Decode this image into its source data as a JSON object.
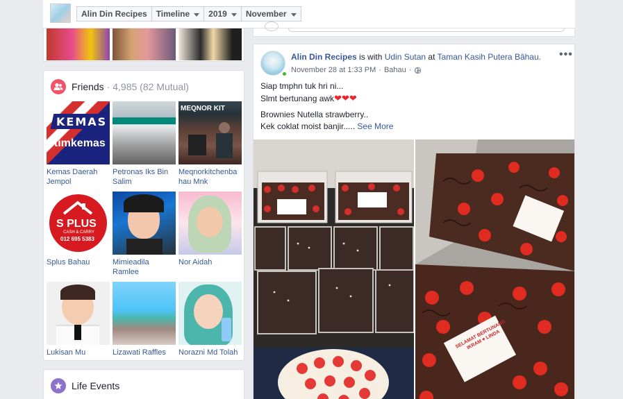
{
  "topbar": {
    "crumbs": [
      {
        "label": "Alin Din Recipes",
        "has_caret": false
      },
      {
        "label": "Timeline",
        "has_caret": true
      },
      {
        "label": "2019",
        "has_caret": true
      },
      {
        "label": "November",
        "has_caret": true
      }
    ]
  },
  "friends": {
    "title": "Friends",
    "subtitle": "· 4,985 (82 Mutual)",
    "items": [
      {
        "name": "Kemas Daerah Jempol"
      },
      {
        "name": "Petronas Iks Bin Salim"
      },
      {
        "name": "Meqnorkitchenba hau Mnk"
      },
      {
        "name": "Splus Bahau"
      },
      {
        "name": "Mimieadila Ramlee"
      },
      {
        "name": "Nor Aidah"
      },
      {
        "name": "Lukisan Mu"
      },
      {
        "name": "Lizawati Raffles"
      },
      {
        "name": "Norazni Md Tolah"
      }
    ],
    "image_text": {
      "kemas_logo": "KEMAS",
      "kemas_hashtag": "#timkemas",
      "meqnor_sign": "MEQNOR KIT",
      "splus_brand": "S PLUS",
      "splus_sub": "CASH & CARRY",
      "splus_phone": "012 695 5383"
    }
  },
  "life_events": {
    "title": "Life Events"
  },
  "post": {
    "author": "Alin Din Recipes",
    "with_text": " is with ",
    "tagged": "Udin Sutan",
    "at_text": " at ",
    "place": "Taman Kasih Putera Bâhau.",
    "date": "November 28 at 1:33 PM",
    "location": "Bahau",
    "line1": "Siap tmphn tuk hri ni...",
    "line2": "Slmt bertunang awk",
    "hearts": "❤❤❤",
    "line3": "Brownies Nutella strawberry..",
    "line4": "Kek coklat moist banjir.....",
    "see_more": "See More",
    "card_text": "SELAMAT BERTUNANG IKRAM ♥ LINDA"
  },
  "colors": {
    "link": "#365899",
    "friends_icon": "#f35369",
    "life_icon": "#8c72cb",
    "online": "#42b72a"
  }
}
